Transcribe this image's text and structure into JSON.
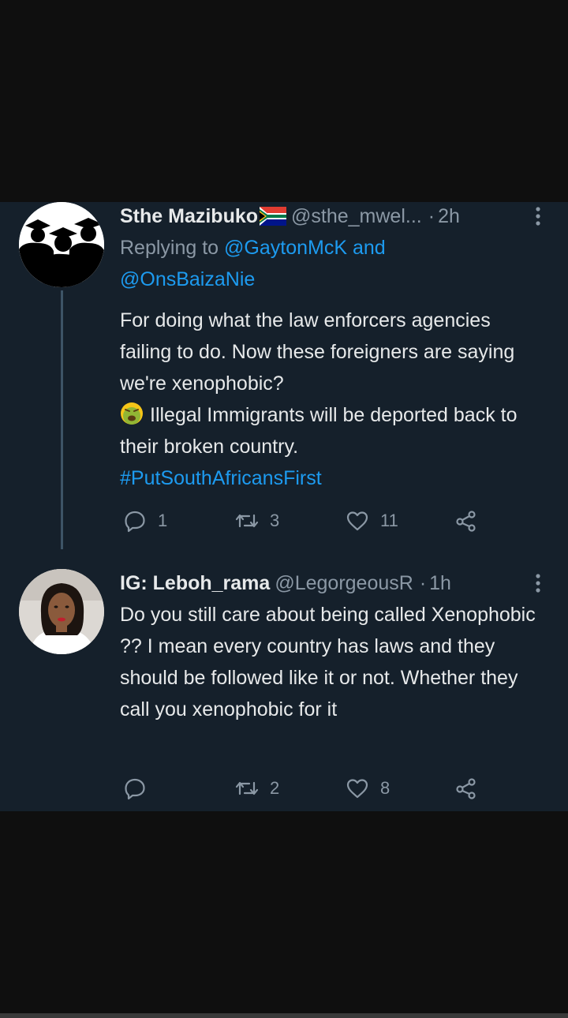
{
  "tweets": [
    {
      "name": "Sthe Mazibuko",
      "handle": "@sthe_mwel...",
      "dot": "·",
      "time": "2h",
      "replying_prefix": "Replying to",
      "replying_user1": "@GaytonMcK",
      "replying_and": "and",
      "replying_user2": "@OnsBaizaNie",
      "text_line1": "For doing what the law enforcers agencies failing to do. Now these foreigners are saying we're xenophobic?",
      "text_line2": "Illegal Immigrants will be deported back to their broken country.",
      "hashtag": "#PutSouthAfricansFirst",
      "reply_count": "1",
      "retweet_count": "3",
      "like_count": "11",
      "name_emoji": "south-africa-flag",
      "text_emoji": "nauseated-face-emoji"
    },
    {
      "name": "IG: Leboh_rama",
      "handle": "@LegorgeousR",
      "dot": "·",
      "time": "1h",
      "text": "Do you still care about being called Xenophobic ?? I mean every country has laws and they should be followed like it or not. Whether they call you xenophobic for it",
      "reply_count": "",
      "retweet_count": "2",
      "like_count": "8"
    }
  ],
  "colors": {
    "background": "#0f0f0f",
    "panel": "#15202b",
    "primary_text": "#e7e9ea",
    "secondary_text": "#8b98a5",
    "link": "#1d9bf0"
  }
}
